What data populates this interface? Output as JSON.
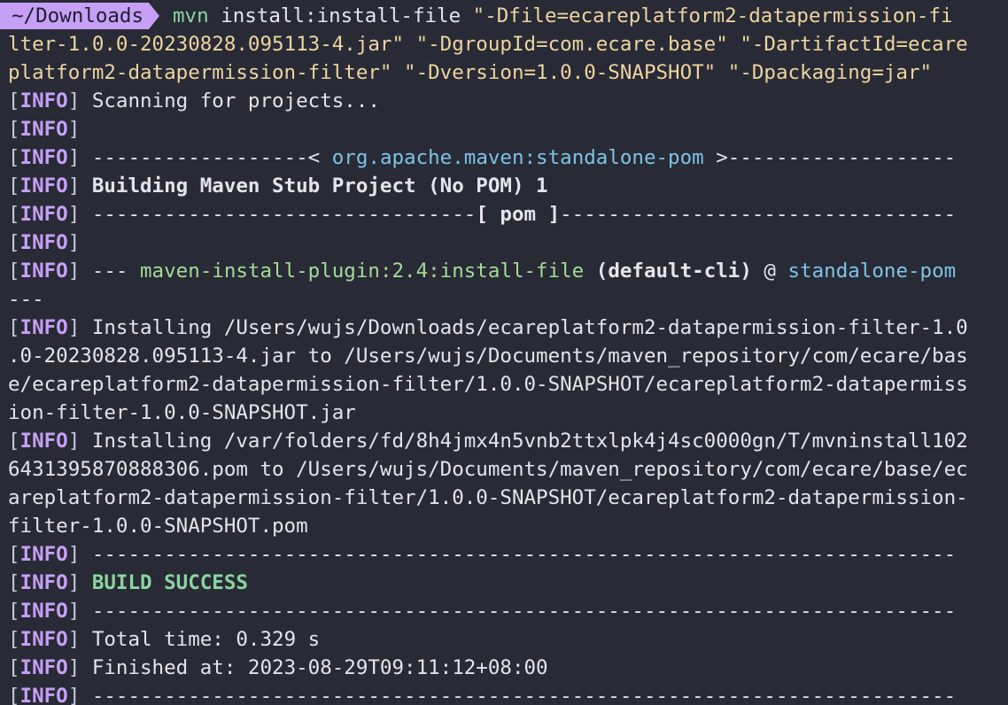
{
  "colors": {
    "background": "#282a36",
    "text": "#e4e4ea",
    "info_bracket": "#c8c8d8",
    "info_tag": "#c6a0f6",
    "command": "#8bd5a0",
    "string": "#eed49f",
    "plugin": "#a6da95",
    "artifact": "#7dc4e4",
    "success": "#8bd5a0",
    "prompt_bg": "#c6a0f6"
  },
  "terminal": {
    "prompt": {
      "dir": "~/Downloads"
    },
    "lines": [
      {
        "type": "command",
        "segments": [
          {
            "t": "mvn",
            "c": "command"
          },
          {
            "t": " install:install-file ",
            "c": "text"
          },
          {
            "t": "\"-Dfile=ecareplatform2-datapermission-fi",
            "c": "string"
          }
        ]
      },
      {
        "type": "plain",
        "segments": [
          {
            "t": "lter-1.0.0-20230828.095113-4.jar\" \"-DgroupId=com.ecare.base\" \"-DartifactId=ecare",
            "c": "string"
          }
        ]
      },
      {
        "type": "plain",
        "segments": [
          {
            "t": "platform2-datapermission-filter\" \"-Dversion=1.0.0-SNAPSHOT\" \"-Dpackaging=jar\"",
            "c": "string"
          }
        ]
      },
      {
        "type": "info",
        "segments": [
          {
            "t": " Scanning for projects...",
            "c": "text"
          }
        ]
      },
      {
        "type": "info",
        "segments": []
      },
      {
        "type": "info",
        "segments": [
          {
            "t": " ------------------< ",
            "c": "text"
          },
          {
            "t": "org.apache.maven:standalone-pom",
            "c": "artifact"
          },
          {
            "t": " >-------------------",
            "c": "text"
          }
        ]
      },
      {
        "type": "info",
        "segments": [
          {
            "t": " Building Maven Stub Project (No POM) 1",
            "c": "bold"
          }
        ]
      },
      {
        "type": "info",
        "segments": [
          {
            "t": " --------------------------------",
            "c": "text"
          },
          {
            "t": "[ pom ]",
            "c": "bold"
          },
          {
            "t": "---------------------------------",
            "c": "text"
          }
        ]
      },
      {
        "type": "info",
        "segments": []
      },
      {
        "type": "info",
        "segments": [
          {
            "t": " --- ",
            "c": "text"
          },
          {
            "t": "maven-install-plugin:2.4:install-file",
            "c": "plugin"
          },
          {
            "t": " ",
            "c": "text"
          },
          {
            "t": "(default-cli)",
            "c": "bold"
          },
          {
            "t": " @ ",
            "c": "text"
          },
          {
            "t": "standalone-pom",
            "c": "artifact"
          }
        ]
      },
      {
        "type": "plain",
        "segments": [
          {
            "t": "---",
            "c": "text"
          }
        ]
      },
      {
        "type": "info",
        "segments": [
          {
            "t": " Installing /Users/wujs/Downloads/ecareplatform2-datapermission-filter-1.0",
            "c": "text"
          }
        ]
      },
      {
        "type": "plain",
        "segments": [
          {
            "t": ".0-20230828.095113-4.jar to /Users/wujs/Documents/maven_repository/com/ecare/bas",
            "c": "text"
          }
        ]
      },
      {
        "type": "plain",
        "segments": [
          {
            "t": "e/ecareplatform2-datapermission-filter/1.0.0-SNAPSHOT/ecareplatform2-datapermiss",
            "c": "text"
          }
        ]
      },
      {
        "type": "plain",
        "segments": [
          {
            "t": "ion-filter-1.0.0-SNAPSHOT.jar",
            "c": "text"
          }
        ]
      },
      {
        "type": "info",
        "segments": [
          {
            "t": " Installing /var/folders/fd/8h4jmx4n5vnb2ttxlpk4j4sc0000gn/T/mvninstall102",
            "c": "text"
          }
        ]
      },
      {
        "type": "plain",
        "segments": [
          {
            "t": "6431395870888306.pom to /Users/wujs/Documents/maven_repository/com/ecare/base/ec",
            "c": "text"
          }
        ]
      },
      {
        "type": "plain",
        "segments": [
          {
            "t": "areplatform2-datapermission-filter/1.0.0-SNAPSHOT/ecareplatform2-datapermission-",
            "c": "text"
          }
        ]
      },
      {
        "type": "plain",
        "segments": [
          {
            "t": "filter-1.0.0-SNAPSHOT.pom",
            "c": "text"
          }
        ]
      },
      {
        "type": "info",
        "segments": [
          {
            "t": " ------------------------------------------------------------------------",
            "c": "text"
          }
        ]
      },
      {
        "type": "info",
        "segments": [
          {
            "t": " ",
            "c": "text"
          },
          {
            "t": "BUILD SUCCESS",
            "c": "success"
          }
        ]
      },
      {
        "type": "info",
        "segments": [
          {
            "t": " ------------------------------------------------------------------------",
            "c": "text"
          }
        ]
      },
      {
        "type": "info",
        "segments": [
          {
            "t": " Total time: 0.329 s",
            "c": "text"
          }
        ]
      },
      {
        "type": "info",
        "segments": [
          {
            "t": " Finished at: 2023-08-29T09:11:12+08:00",
            "c": "text"
          }
        ]
      },
      {
        "type": "info",
        "segments": [
          {
            "t": " ------------------------------------------------------------------------",
            "c": "text"
          }
        ]
      }
    ],
    "info_tag": "INFO"
  }
}
